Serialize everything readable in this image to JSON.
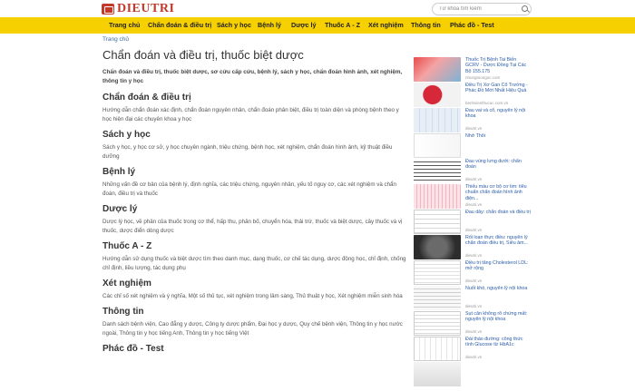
{
  "header": {
    "logo_text": "DIEUTRI",
    "search_placeholder": "Từ khóa tìm kiếm"
  },
  "nav": [
    {
      "label": "Trang chủ"
    },
    {
      "label": "Chẩn đoán & điều trị"
    },
    {
      "label": "Sách y học"
    },
    {
      "label": "Bệnh lý"
    },
    {
      "label": "Dược lý"
    },
    {
      "label": "Thuốc A - Z"
    },
    {
      "label": "Xét nghiệm"
    },
    {
      "label": "Thông tin"
    },
    {
      "label": "Phác đồ - Test"
    }
  ],
  "breadcrumb": "Trang chủ",
  "main": {
    "title": "Chẩn đoán và điều trị, thuốc biệt dược",
    "intro": "Chẩn đoán và điều trị, thuốc biệt dược, sơ cứu cấp cứu, bệnh lý, sách y học, chẩn đoán hình ảnh, xét nghiệm, thông tin y học",
    "sections": [
      {
        "title": "Chẩn đoán & điều trị",
        "desc": "Hướng dẫn chẩn đoán xác định, chẩn đoán nguyên nhân, chẩn đoán phân biệt, điều trị toàn diện và phòng bệnh theo y học hiện đại các chuyên khoa y học"
      },
      {
        "title": "Sách y học",
        "desc": "Sách y học, y học cơ sở, y học chuyên ngành, triệu chứng, bệnh học, xét nghiệm, chẩn đoán hình ảnh, kỹ thuật điều dưỡng"
      },
      {
        "title": "Bệnh lý",
        "desc": "Những vấn đề cơ bản của bệnh lý, định nghĩa, các triệu chứng, nguyên nhân, yếu tố nguy cơ, các xét nghiệm và chẩn đoán, điều trị và thuốc"
      },
      {
        "title": "Dược lý",
        "desc": "Dược lý học, về phân của thuốc trong cơ thể, hấp thu, phân bố, chuyển hóa, thải trừ, thuốc và biệt dược, cây thuốc và vị thuốc, dược điển dòng dược"
      },
      {
        "title": "Thuốc A - Z",
        "desc": "Hướng dẫn sử dụng thuốc và biệt dược tìm theo danh mục, dạng thuốc, cơ chế tác dụng, dược động học, chỉ định, chống chỉ định, liều lượng, tác dụng phụ"
      },
      {
        "title": "Xét nghiệm",
        "desc": "Các chỉ số xét nghiệm và ý nghĩa, Một số thủ tục, xét nghiệm trong lâm sàng, Thủ thuật y học, Xét nghiệm miễn sinh hóa"
      },
      {
        "title": "Thông tin",
        "desc": "Danh sách bệnh viện, Cao đẳng y dược, Công ty dược phẩm, Đại học y dược, Quy chế bệnh viện, Thông tin y học nước ngoài, Thông tin y học tiếng Anh, Thông tin y học tiếng Việt"
      },
      {
        "title": "Phác đồ - Test",
        "desc": ""
      }
    ]
  },
  "sidebar": [
    {
      "title": "Thuốc Trị Bệnh Tai Biến GCRV - Dược Đồng Tại Các Bộ 155.175",
      "source": "nhungtuongoc.com"
    },
    {
      "title": "Điều Trị Xơ Gan Cổ Trướng - Phác Đồ Mới Nhất Hiệu Quả",
      "source": "benhvienthucuc.com.vn"
    },
    {
      "title": "Đau vai và cổ, nguyên lý nội khoa",
      "source": "dieutri.vn"
    },
    {
      "title": "Nhớ Thôi",
      "source": ""
    },
    {
      "title": "Đau vùng lưng dưới: chẩn đoán",
      "source": "dieutri.vn"
    },
    {
      "title": "Thiếu máu cơ bộ cơ tim: tiêu chuẩn chẩn đoán hình ảnh điện...",
      "source": "dieutri.vn"
    },
    {
      "title": "Đau dây: chẩn đoán và điều trị",
      "source": "dieutri.vn"
    },
    {
      "title": "Rối loạn thực điều: nguyên lý chẩn đoán điều trị, Siêu âm...",
      "source": "dieutri.vn"
    },
    {
      "title": "Điều trị tăng Cholesterol LDL: mở rộng",
      "source": "dieutri.vn"
    },
    {
      "title": "Nuốt khó, nguyên lý nội khoa",
      "source": "dieutri.vn"
    },
    {
      "title": "Sụt cân không rõ chứng mất: nguyên lý nội khoa",
      "source": "dieutri.vn"
    },
    {
      "title": "Đái tháo đường: công thức tính Glucose từ HbA1c",
      "source": "dieutri.vn"
    },
    {
      "title": "",
      "source": ""
    }
  ]
}
